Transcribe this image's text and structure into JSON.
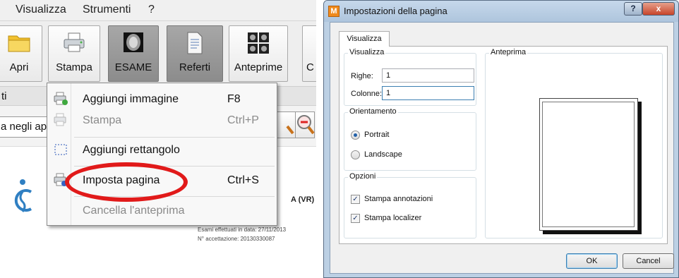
{
  "app": {
    "menu": [
      "Visualizza",
      "Strumenti",
      "?"
    ],
    "toolbar": [
      {
        "label": "Apri",
        "icon": "folder-icon"
      },
      {
        "label": "Stampa",
        "icon": "printer-icon"
      },
      {
        "label": "ESAME",
        "icon": "brain-scan-icon"
      },
      {
        "label": "Referti",
        "icon": "document-icon"
      },
      {
        "label": "Anteprime",
        "icon": "thumbnails-icon"
      },
      {
        "label": "C",
        "icon": ""
      }
    ],
    "row2_text": "ti",
    "row3_text": "a negli ap",
    "doc_line1": "A (VR)",
    "doc_line2": "Esami effettuati in data: 27/11/2013",
    "doc_line3": "N° accettazione: 20130330087"
  },
  "stampa_menu": {
    "items": [
      {
        "label": "Aggiungi immagine",
        "shortcut": "F8",
        "enabled": true,
        "icon": "add-image-icon"
      },
      {
        "label": "Stampa",
        "shortcut": "Ctrl+P",
        "enabled": false,
        "icon": "printer-icon"
      },
      {
        "label": "Aggiungi rettangolo",
        "shortcut": "",
        "enabled": true,
        "icon": "dashed-rectangle-icon"
      },
      {
        "label": "Imposta pagina",
        "shortcut": "Ctrl+S",
        "enabled": true,
        "icon": "page-setup-icon"
      },
      {
        "label": "Cancella l'anteprima",
        "shortcut": "",
        "enabled": false,
        "icon": ""
      }
    ],
    "highlight_color": "#e11a1a"
  },
  "dialog": {
    "title": "Impostazioni della pagina",
    "help_label": "?",
    "close_label": "x",
    "tab": "Visualizza",
    "group_visualizza": {
      "title": "Visualizza",
      "righe_label": "Righe:",
      "righe_value": "1",
      "colonne_label": "Colonne:",
      "colonne_value": "1"
    },
    "group_orientamento": {
      "title": "Orientamento",
      "options": [
        "Portrait",
        "Landscape"
      ],
      "selected": "Portrait"
    },
    "group_opzioni": {
      "title": "Opzioni",
      "checks": [
        {
          "label": "Stampa annotazioni",
          "checked": true
        },
        {
          "label": "Stampa localizer",
          "checked": true
        }
      ]
    },
    "anteprima_title": "Anteprima",
    "ok_label": "OK",
    "cancel_label": "Cancel"
  }
}
